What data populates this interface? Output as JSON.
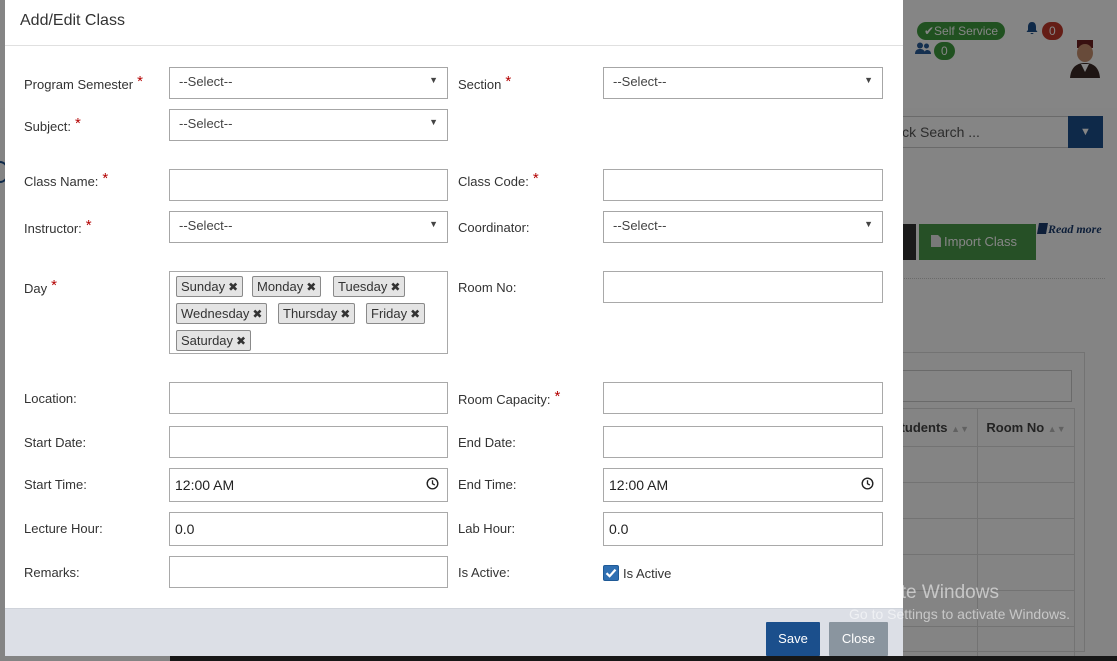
{
  "modal": {
    "title": "Add/Edit Class",
    "fields": {
      "program_semester": {
        "label": "Program Semester",
        "value": "--Select--"
      },
      "section": {
        "label": "Section",
        "value": "--Select--"
      },
      "subject": {
        "label": "Subject:",
        "value": "--Select--"
      },
      "class_name": {
        "label": "Class Name:",
        "value": ""
      },
      "class_code": {
        "label": "Class Code:",
        "value": ""
      },
      "instructor": {
        "label": "Instructor:",
        "value": "--Select--"
      },
      "coordinator": {
        "label": "Coordinator:",
        "value": "--Select--"
      },
      "day": {
        "label": "Day",
        "chips": [
          "Sunday",
          "Monday",
          "Tuesday",
          "Wednesday",
          "Thursday",
          "Friday",
          "Saturday"
        ]
      },
      "room_no": {
        "label": "Room No:",
        "value": ""
      },
      "location": {
        "label": "Location:",
        "value": ""
      },
      "room_capacity": {
        "label": "Room Capacity:",
        "value": ""
      },
      "start_date": {
        "label": "Start Date:",
        "value": ""
      },
      "end_date": {
        "label": "End Date:",
        "value": ""
      },
      "start_time": {
        "label": "Start Time:",
        "value": "12:00 AM"
      },
      "end_time": {
        "label": "End Time:",
        "value": "12:00 AM"
      },
      "lecture_hour": {
        "label": "Lecture Hour:",
        "value": "0.0"
      },
      "lab_hour": {
        "label": "Lab Hour:",
        "value": "0.0"
      },
      "remarks": {
        "label": "Remarks:",
        "value": ""
      },
      "is_active": {
        "label": "Is Active:",
        "checkbox_label": "Is Active",
        "checked": true
      }
    },
    "required_marker": "*",
    "chip_remove": "✖",
    "buttons": {
      "save": "Save",
      "close": "Close"
    }
  },
  "background": {
    "self_service": "✔Self Service",
    "notifications": "0",
    "users": "0",
    "quick_search": "ick Search ...",
    "import_class": "Import Class",
    "read_more": "Read more",
    "columns": [
      "Students",
      "Room No"
    ]
  },
  "watermark": {
    "line1": "Activate Windows",
    "line2": "Go to Settings to activate Windows."
  },
  "icons": {
    "caret": "caret-down-icon",
    "clock": "clock-icon",
    "check": "check-icon",
    "bell": "bell-icon",
    "users": "users-icon",
    "file": "file-icon",
    "book": "book-icon",
    "remove": "remove-chip-icon"
  },
  "colors": {
    "primary": "#1b4f8c",
    "success": "#3e9b3e",
    "danger": "#c0392b",
    "required": "#b30000",
    "close_button": "#8a959f",
    "checkbox": "#2f6fb2"
  }
}
